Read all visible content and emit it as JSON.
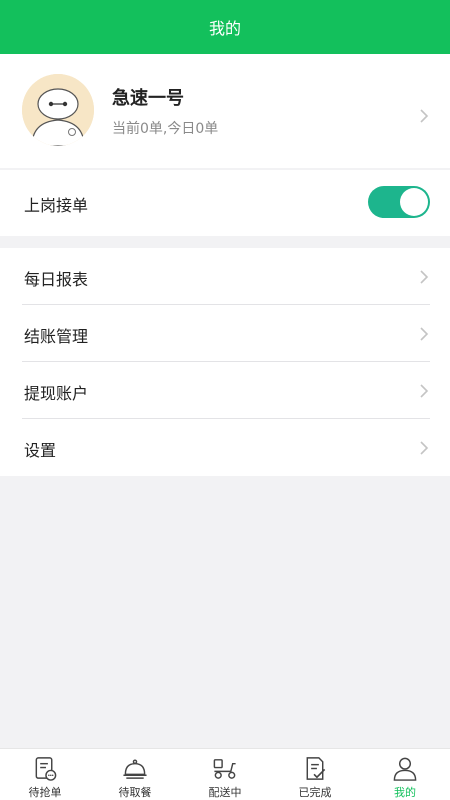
{
  "header": {
    "title": "我的"
  },
  "profile": {
    "name": "急速一号",
    "stats": "当前0单,今日0单"
  },
  "duty": {
    "label": "上岗接单",
    "on": true
  },
  "menu": {
    "items": [
      {
        "label": "每日报表"
      },
      {
        "label": "结账管理"
      },
      {
        "label": "提现账户"
      },
      {
        "label": "设置"
      }
    ]
  },
  "tabbar": {
    "items": [
      {
        "label": "待抢单",
        "icon": "order-list-icon"
      },
      {
        "label": "待取餐",
        "icon": "dish-cover-icon"
      },
      {
        "label": "配送中",
        "icon": "scooter-icon"
      },
      {
        "label": "已完成",
        "icon": "completed-doc-icon"
      },
      {
        "label": "我的",
        "icon": "person-icon",
        "active": true
      }
    ]
  },
  "colors": {
    "brand": "#13c05c",
    "toggle_on": "#1db58d",
    "active_tab": "#13c05c"
  }
}
